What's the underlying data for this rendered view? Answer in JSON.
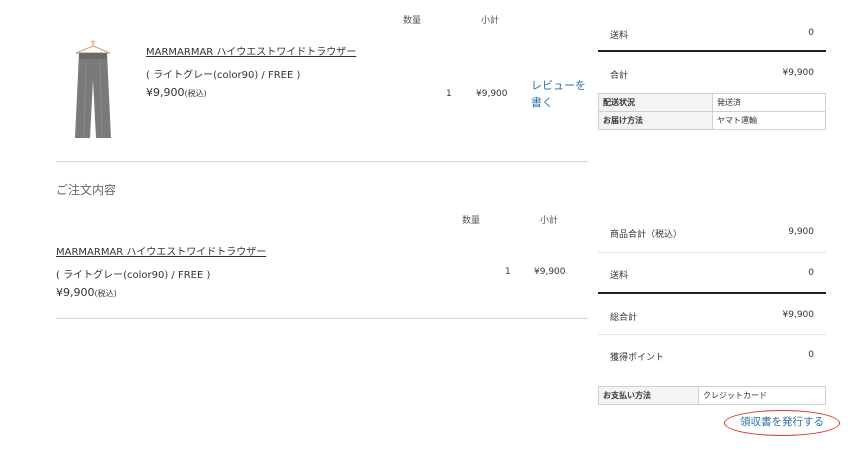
{
  "top_order": {
    "headers": {
      "qty": "数量",
      "subtotal": "小計"
    },
    "item": {
      "name": "MARMARMAR ハイウエストワイドトラウザー",
      "variant": "( ライトグレー(color90) / FREE )",
      "price": "¥9,900",
      "tax_note": "(税込)",
      "qty": "1",
      "subtotal": "¥9,900",
      "review_link": "レビューを書く"
    }
  },
  "top_summary": {
    "shipping_label": "送料",
    "shipping_value": "0",
    "total_label": "合計",
    "total_value": "¥9,900",
    "info": [
      {
        "key": "配送状況",
        "value": "発送済"
      },
      {
        "key": "お届け方法",
        "value": "ヤマト運輸"
      }
    ]
  },
  "order_details": {
    "title": "ご注文内容",
    "headers": {
      "qty": "数量",
      "subtotal": "小計"
    },
    "item": {
      "name": "MARMARMAR ハイウエストワイドトラウザー",
      "variant": "( ライトグレー(color90) / FREE )",
      "price": "¥9,900",
      "tax_note": "(税込)",
      "qty": "1",
      "subtotal": "¥9,900"
    }
  },
  "bottom_summary": {
    "rows": [
      {
        "label": "商品合計（税込）",
        "value": "9,900"
      },
      {
        "label": "送料",
        "value": "0"
      },
      {
        "label": "総合計",
        "value": "¥9,900"
      },
      {
        "label": "獲得ポイント",
        "value": "0"
      }
    ],
    "payment": {
      "key": "お支払い方法",
      "value": "クレジットカード"
    },
    "receipt_button": "領収書を発行する"
  },
  "colors": {
    "link": "#2d6fa8",
    "receipt_circle": "#d9342c",
    "rule_dark": "#222222"
  }
}
